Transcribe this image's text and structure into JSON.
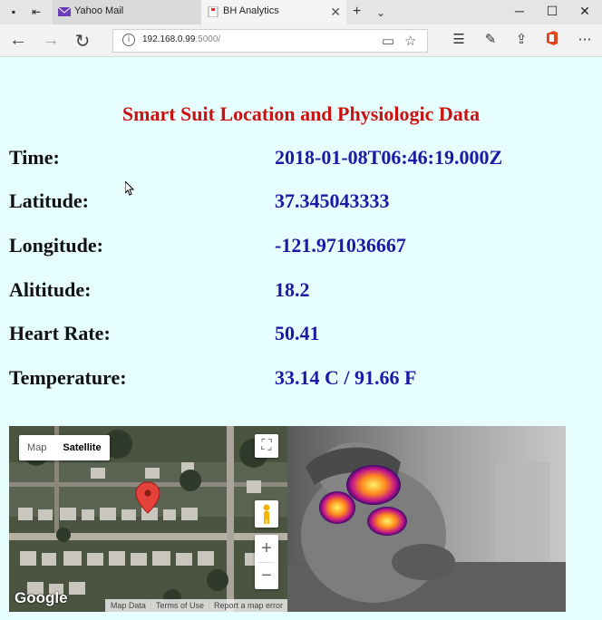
{
  "browser": {
    "tabs": [
      {
        "label": "Yahoo Mail",
        "favicon": "yahoo-mail-icon"
      },
      {
        "label": "BH Analytics",
        "favicon": "page-icon"
      }
    ],
    "address": {
      "host": "192.168.0.99",
      "port": ":5000/"
    }
  },
  "page": {
    "title": "Smart Suit Location and Physiologic Data",
    "rows": [
      {
        "label": "Time:",
        "value": "2018-01-08T06:46:19.000Z"
      },
      {
        "label": "Latitude:",
        "value": "37.345043333"
      },
      {
        "label": "Longitude:",
        "value": "-121.971036667"
      },
      {
        "label": "Alititude:",
        "value": "18.2"
      },
      {
        "label": "Heart Rate:",
        "value": "50.41"
      },
      {
        "label": "Temperature:",
        "value": "33.14 C / 91.66 F"
      }
    ]
  },
  "map": {
    "map_button": "Map",
    "satellite_button": "Satellite",
    "zoom_in": "+",
    "zoom_out": "−",
    "logo": "Google",
    "footer": {
      "map_data": "Map Data",
      "terms": "Terms of Use",
      "report": "Report a map error"
    }
  },
  "colors": {
    "title": "#cc1111",
    "value": "#1a1aa6",
    "background": "#e6fefe"
  }
}
